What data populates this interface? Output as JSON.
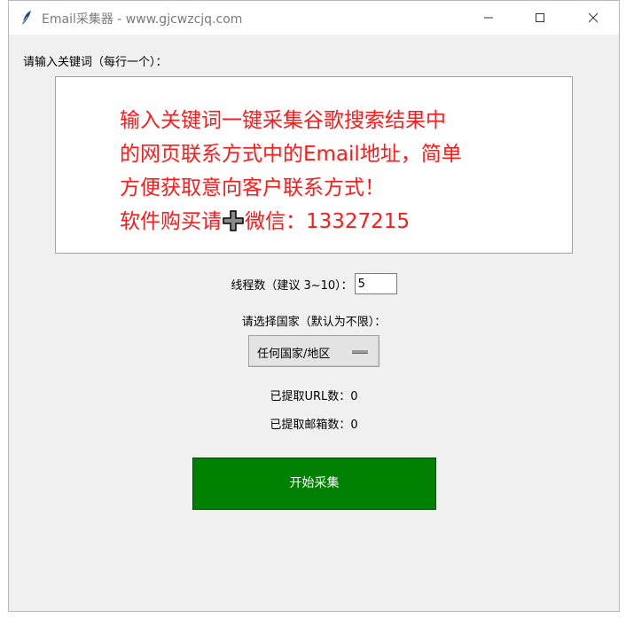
{
  "window": {
    "title": "Email采集器 - www.gjcwzcjq.com"
  },
  "keywords": {
    "label": "请输入关键词（每行一个）：",
    "text_part1": "输入关键词一键采集谷歌搜索结果中\n的网页联系方式中的Email地址，简单\n方便获取意向客户联系方式！\n软件购买请",
    "text_part2": "微信：13327215"
  },
  "threads": {
    "label": "线程数（建议 3~10）：",
    "value": "5"
  },
  "country": {
    "label": "请选择国家（默认为不限）：",
    "selected": "任何国家/地区"
  },
  "stats": {
    "url_label": "已提取URL数：",
    "url_count": "0",
    "email_label": "已提取邮箱数：",
    "email_count": "0"
  },
  "start_button": {
    "label": "开始采集"
  },
  "colors": {
    "accent_red": "#ff1a1a",
    "button_green": "#008000"
  }
}
